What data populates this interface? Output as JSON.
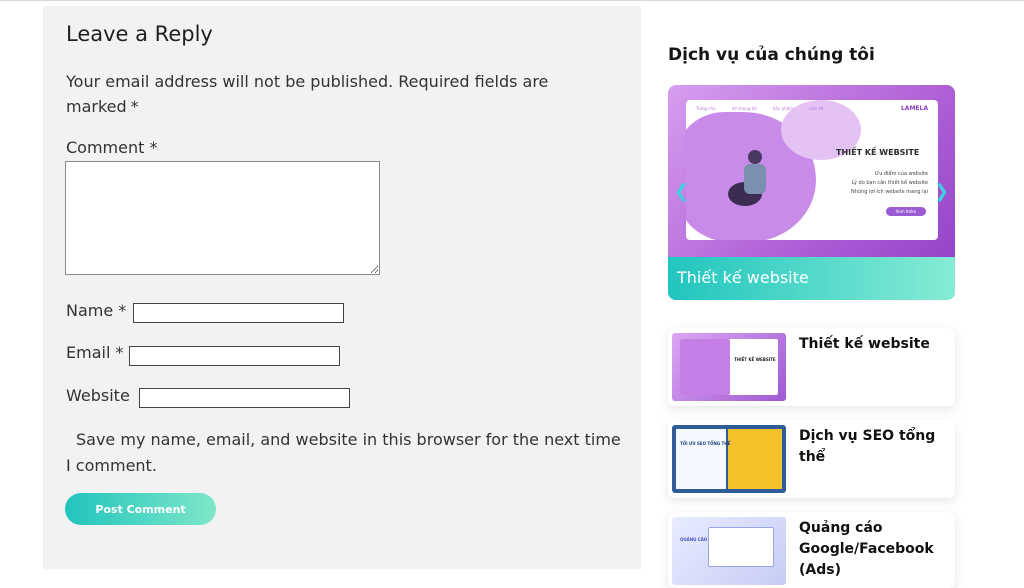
{
  "reply": {
    "title": "Leave a Reply",
    "notes": "Your email address will not be published. Required fields are marked",
    "required_mark": "*",
    "comment_label": "Comment *",
    "name_label": "Name *",
    "email_label": "Email *",
    "website_label": "Website",
    "consent_text": "Save my name, email, and website in this browser for the next time I comment.",
    "submit_label": "Post Comment"
  },
  "sidebar": {
    "title": "Dịch vụ của chúng tôi",
    "featured": {
      "caption": "Thiết kế website",
      "banner": {
        "nav": [
          "Trang chủ",
          "Về chúng tôi",
          "Sản phẩm",
          "Liên hệ"
        ],
        "logo": "LAMELA",
        "heading": "THIẾT KẾ WEBSITE",
        "lines": [
          "Ưu điểm của website",
          "Lý do bạn cần thiết kế website",
          "Những lợi ích website mang lại"
        ],
        "button": "Xem thêm"
      }
    },
    "posts": [
      {
        "title": "Thiết kế website",
        "thumb_text": "THIẾT KẾ WEBSITE"
      },
      {
        "title": "Dịch vụ SEO tổng thể",
        "thumb_text": "TỐI ƯU SEO TỔNG THỂ"
      },
      {
        "title": "Quảng cáo Google/Facebook (Ads)",
        "thumb_text": "QUẢNG CÁO"
      }
    ]
  },
  "colors": {
    "accent_start": "#20c4bd",
    "accent_end": "#7fe7c9",
    "panel_bg": "#f2f2f2",
    "banner_purple": "#b061d6"
  }
}
